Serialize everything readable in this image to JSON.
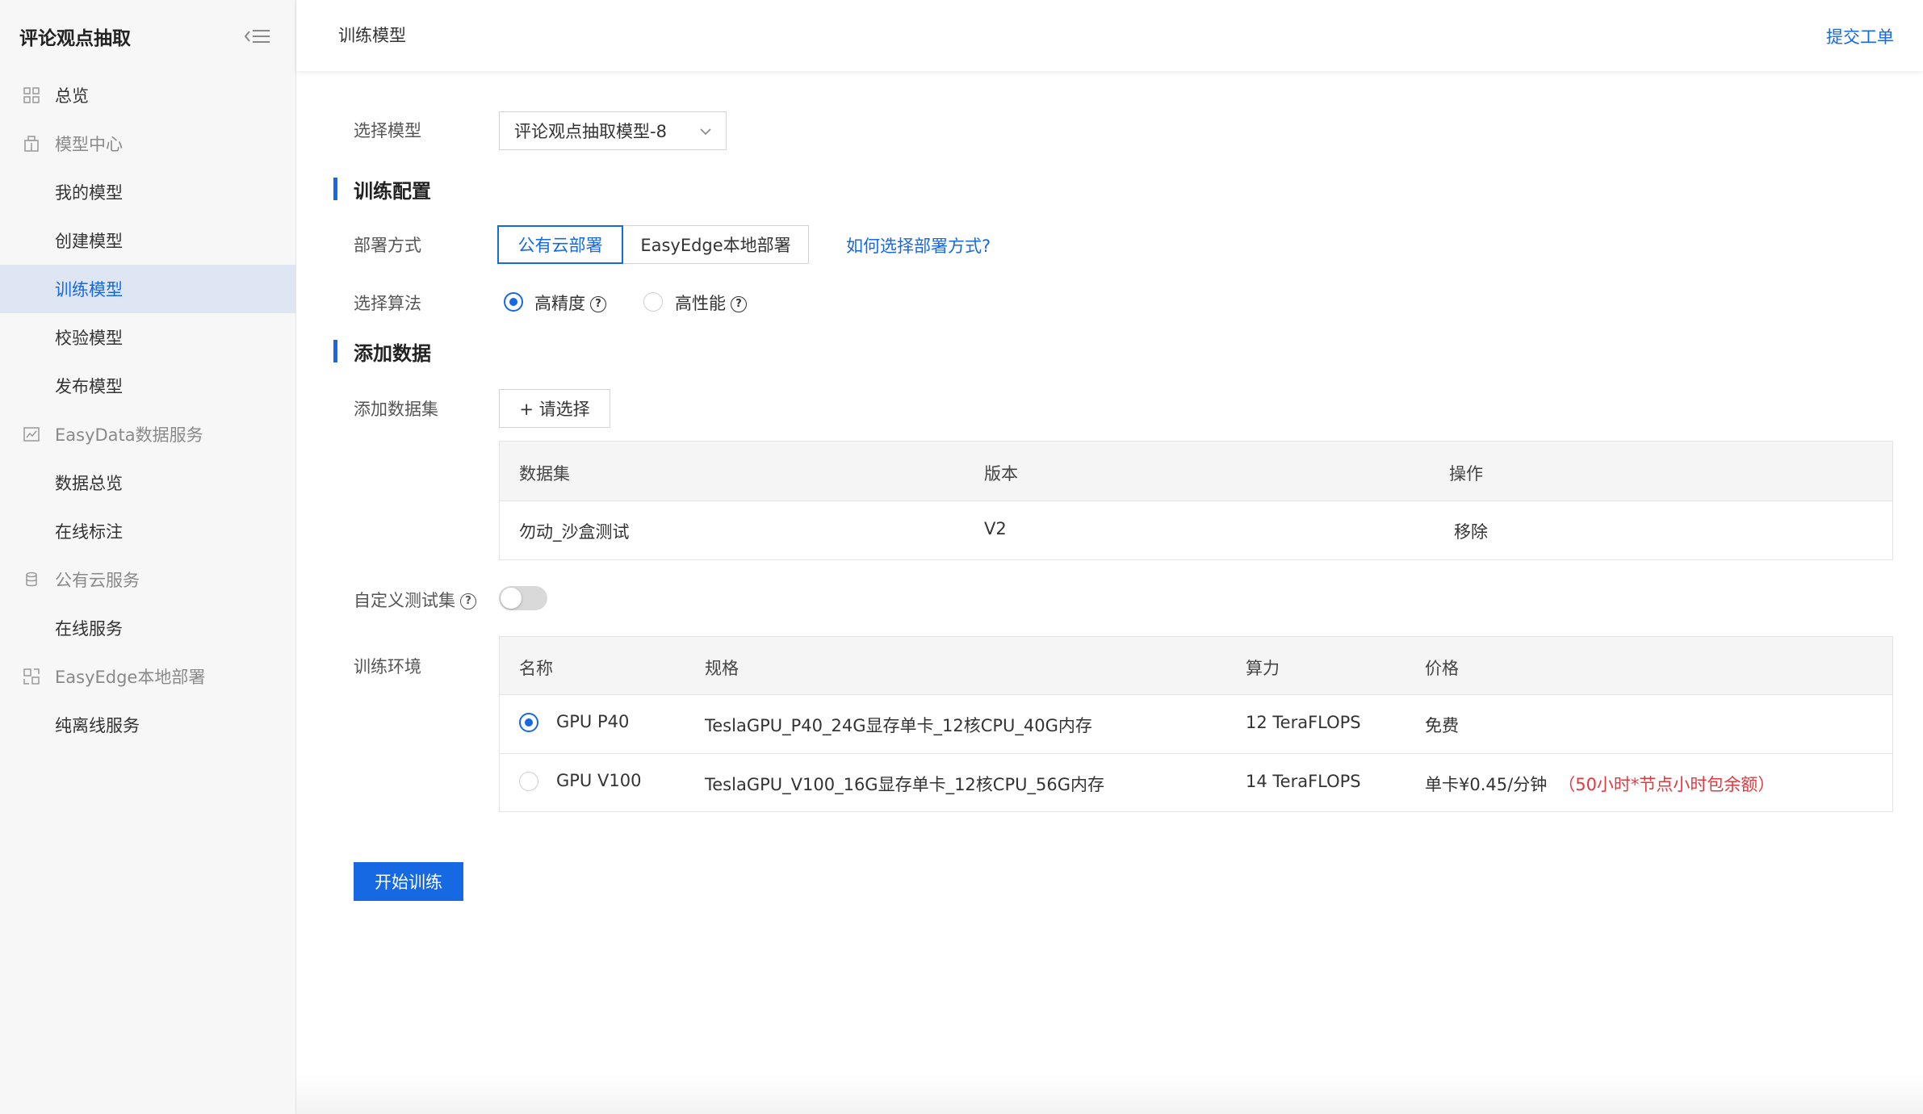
{
  "sidebar": {
    "title": "评论观点抽取",
    "items": [
      {
        "label": "总览",
        "kind": "top",
        "icon": "grid-icon"
      },
      {
        "label": "模型中心",
        "kind": "group",
        "icon": "building-icon"
      },
      {
        "label": "我的模型",
        "kind": "child"
      },
      {
        "label": "创建模型",
        "kind": "child"
      },
      {
        "label": "训练模型",
        "kind": "child",
        "active": true
      },
      {
        "label": "校验模型",
        "kind": "child"
      },
      {
        "label": "发布模型",
        "kind": "child"
      },
      {
        "label": "EasyData数据服务",
        "kind": "group",
        "icon": "chart-icon"
      },
      {
        "label": "数据总览",
        "kind": "child"
      },
      {
        "label": "在线标注",
        "kind": "child"
      },
      {
        "label": "公有云服务",
        "kind": "group",
        "icon": "database-icon"
      },
      {
        "label": "在线服务",
        "kind": "child"
      },
      {
        "label": "EasyEdge本地部署",
        "kind": "group",
        "icon": "deploy-icon"
      },
      {
        "label": "纯离线服务",
        "kind": "child"
      }
    ]
  },
  "header": {
    "title": "训练模型",
    "ticket": "提交工单"
  },
  "form": {
    "model_label": "选择模型",
    "model_value": "评论观点抽取模型-8",
    "section_train": "训练配置",
    "deploy_label": "部署方式",
    "deploy_options": [
      "公有云部署",
      "EasyEdge本地部署"
    ],
    "deploy_selected": "公有云部署",
    "deploy_help": "如何选择部署方式?",
    "algo_label": "选择算法",
    "algo_options": [
      "高精度",
      "高性能"
    ],
    "algo_selected": "高精度",
    "section_data": "添加数据",
    "dataset_label": "添加数据集",
    "dataset_button": "+ 请选择",
    "dataset_table": {
      "headers": [
        "数据集",
        "版本",
        "操作"
      ],
      "rows": [
        {
          "name": "勿动_沙盒测试",
          "version": "V2",
          "action": "移除"
        }
      ]
    },
    "custom_test_label": "自定义测试集",
    "custom_test_on": false,
    "env_label": "训练环境",
    "env_table": {
      "headers": [
        "名称",
        "规格",
        "算力",
        "价格"
      ],
      "rows": [
        {
          "name": "GPU P40",
          "spec": "TeslaGPU_P40_24G显存单卡_12核CPU_40G内存",
          "power": "12 TeraFLOPS",
          "price": "免费",
          "note": "",
          "selected": true
        },
        {
          "name": "GPU V100",
          "spec": "TeslaGPU_V100_16G显存单卡_12核CPU_56G内存",
          "power": "14 TeraFLOPS",
          "price": "单卡¥0.45/分钟",
          "note": "（50小时*节点小时包余额）",
          "selected": false
        }
      ]
    },
    "start_button": "开始训练"
  },
  "colors": {
    "accent": "#1668e3",
    "warning": "#e0393e",
    "sidebar_bg": "#f7f7f7",
    "active_bg": "#dde6f2"
  }
}
